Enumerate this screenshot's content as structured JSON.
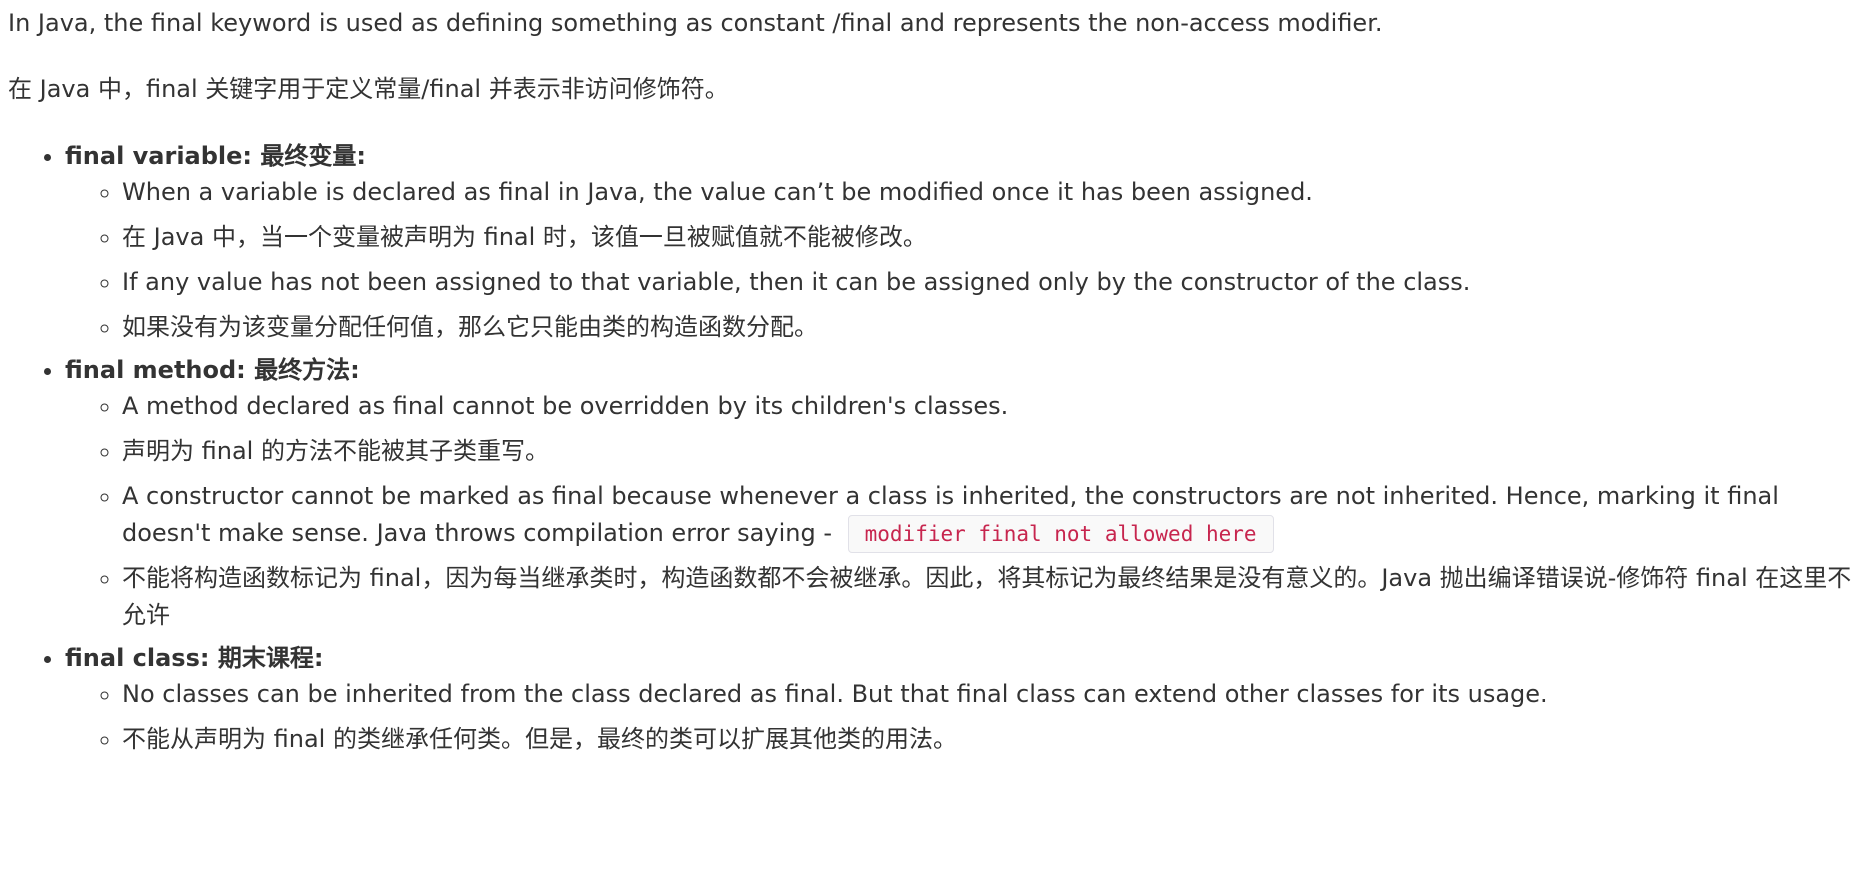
{
  "intro": {
    "en": "In Java, the final keyword is used as defining something as constant /final and represents the non-access modifier.",
    "zh": "在 Java 中，final 关键字用于定义常量/final 并表示非访问修饰符。"
  },
  "sections": [
    {
      "title": "final variable:   最终变量:",
      "items": [
        "When a variable is declared as final in Java, the value can’t be modified once it has been assigned.",
        "在 Java 中，当一个变量被声明为 final 时，该值一旦被赋值就不能被修改。",
        "If any value has not been assigned to that variable, then it can be assigned only by the constructor of the class.",
        "如果没有为该变量分配任何值，那么它只能由类的构造函数分配。"
      ]
    },
    {
      "title": "final method:   最终方法:",
      "items": [
        "A method declared as final cannot be overridden by its children's classes.",
        "声明为 final 的方法不能被其子类重写。",
        "A constructor cannot be marked as final because whenever a class is inherited, the constructors are not inherited. Hence, marking it final doesn't make sense. Java throws compilation error saying -",
        "不能将构造函数标记为 final，因为每当继承类时，构造函数都不会被继承。因此，将其标记为最终结果是没有意义的。Java 抛出编译错误说-修饰符 final 在这里不允许"
      ],
      "code": "modifier final not allowed here"
    },
    {
      "title": "final class:   期末课程:",
      "items": [
        "No classes can be inherited from the class declared as final. But that final class can extend other classes for its usage.",
        "不能从声明为 final 的类继承任何类。但是，最终的类可以扩展其他类的用法。"
      ]
    }
  ]
}
